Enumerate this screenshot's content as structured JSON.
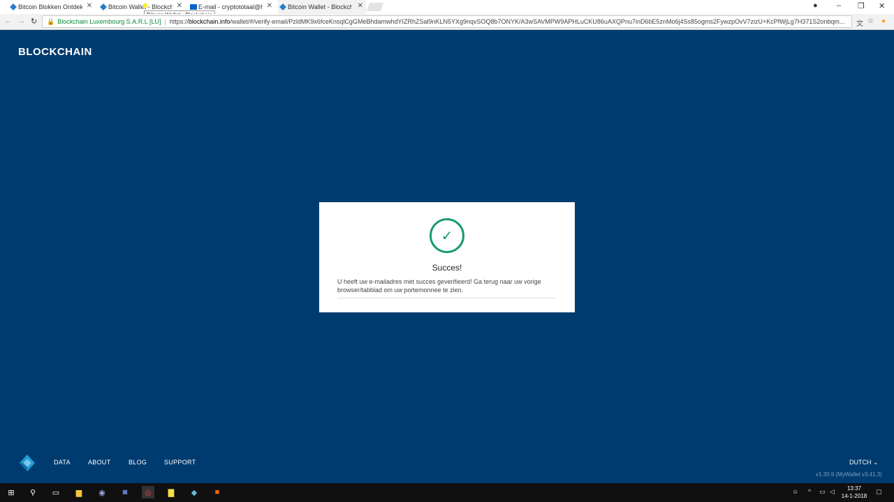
{
  "browser": {
    "tabs": [
      {
        "label": "Bitcoin Blokken Ontdekk",
        "active": false
      },
      {
        "label": "Bitcoin Wallet - Blockchain",
        "active": false
      },
      {
        "label": "E-mail - cryptototaal@h",
        "active": false
      },
      {
        "label": "Bitcoin Wallet - Blockchain",
        "active": true
      }
    ],
    "tooltip": "Bitcoin Wallet - Blockchain",
    "site_identity": "Blockchain Luxembourg S.A.R.L [LU]",
    "url_scheme": "https://",
    "url_host": "blockchain.info",
    "url_path": "/wallet/#/verify-email/PzldMK9x6fceKnsqlCgGMeBhdamwhdYIZRhZSal9nKLN5YXg9nqvSOQ8b7ONYK/A3wSAVMPW9APHLuCKU86uAXQPnu7inD6bE5znMo6j4Ss85ogms2FywzpOvV7zizU+KcPfWjLg7H371S2onbqm..."
  },
  "header": {
    "brand": "BLOCKCHAIN"
  },
  "card": {
    "title": "Succes!",
    "message": "U heeft uw e-mailadres met succes geverifieerd! Ga terug naar uw vorige browser/tabblad om uw portemonnee te zien."
  },
  "footer": {
    "links": [
      "DATA",
      "ABOUT",
      "BLOG",
      "SUPPORT"
    ],
    "language": "DUTCH",
    "version": "v1.30.9  (MyWallet v3.41.3)"
  },
  "taskbar": {
    "time": "13:37",
    "date": "14-1-2018"
  },
  "colors": {
    "page_bg": "#003b6f",
    "success_green": "#199b6b"
  }
}
